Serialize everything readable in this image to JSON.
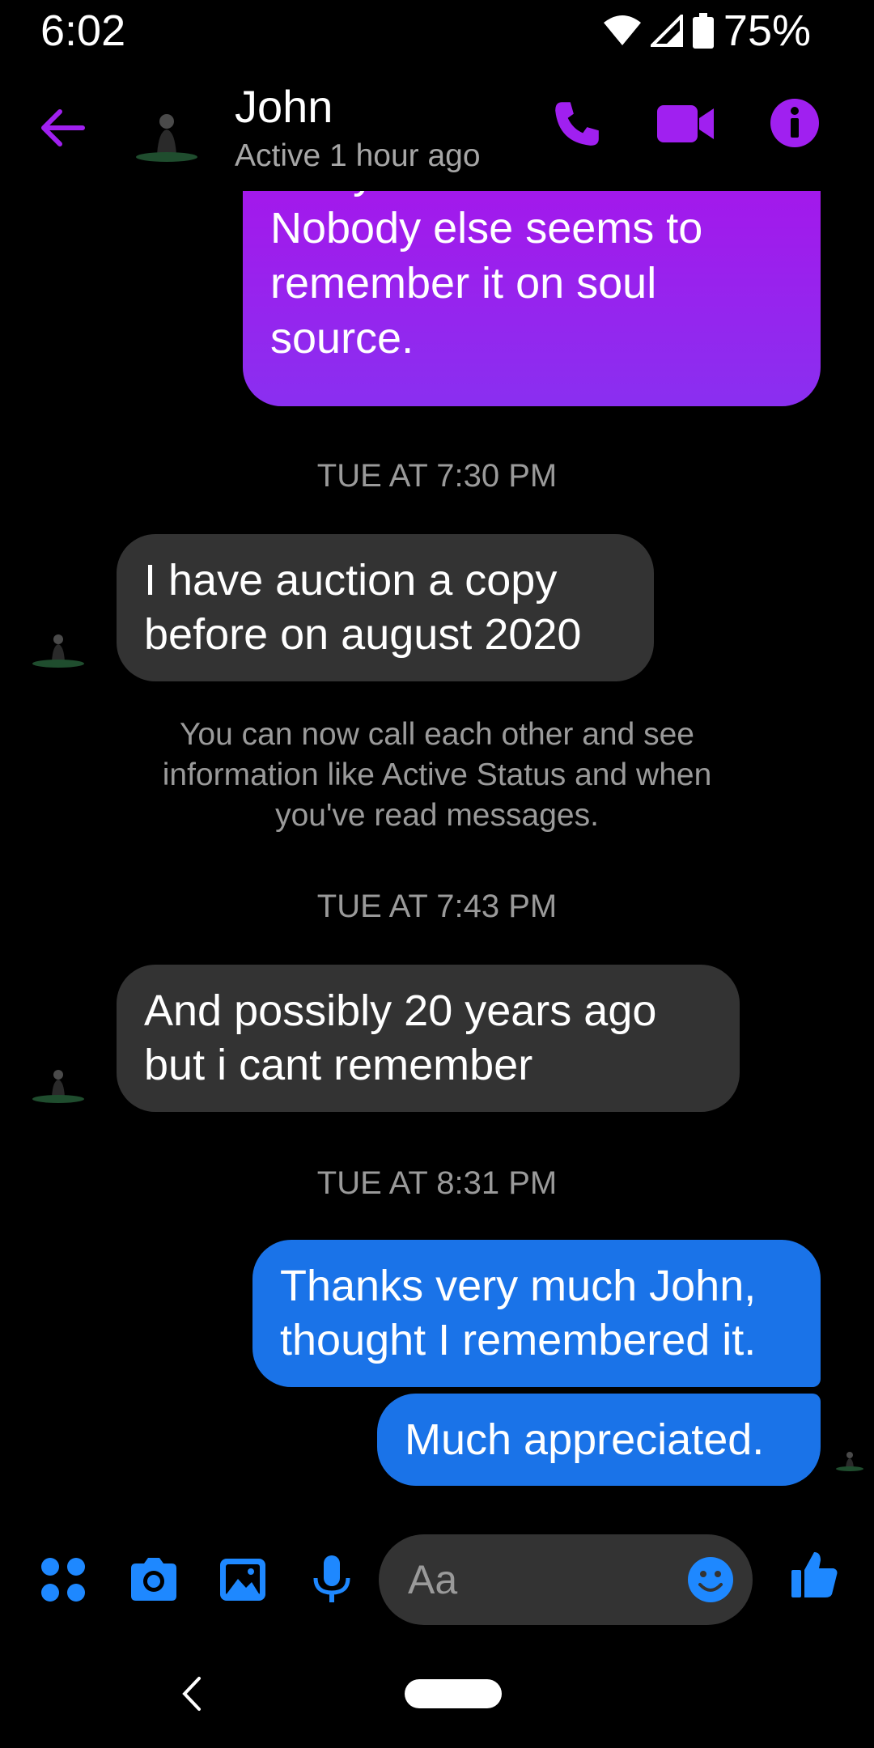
{
  "status_bar": {
    "time": "6:02",
    "battery": "75%"
  },
  "header": {
    "name": "John",
    "status": "Active 1 hour ago",
    "icons": [
      "back-arrow-icon",
      "phone-icon",
      "video-camera-icon",
      "info-icon"
    ]
  },
  "colors": {
    "accent": "#a020f0",
    "sent_purple_top": "#a814ea",
    "sent_purple_bottom": "#8a2ff0",
    "sent_blue": "#1a73e8",
    "received_bg": "#333333",
    "icon_blue": "#1e88ff"
  },
  "messages": [
    {
      "side": "sent",
      "text": "can you confirm?\nNobody else seems to\nremember it on soul\nsource."
    },
    {
      "timestamp": "TUE AT 7:30 PM"
    },
    {
      "side": "received",
      "text": "I have auction a copy\nbefore  on august 2020"
    },
    {
      "notice": "You can now call each other and see information like Active Status and when you've read messages."
    },
    {
      "timestamp": "TUE AT 7:43 PM"
    },
    {
      "side": "received",
      "text": "And possibly 20 years ago\nbut i cant remember"
    },
    {
      "timestamp": "TUE AT 8:31 PM"
    },
    {
      "side": "sent",
      "text": "Thanks very much John,\nthought I remembered it."
    },
    {
      "side": "sent",
      "text": "Much appreciated."
    }
  ],
  "composer": {
    "placeholder": "Aa",
    "icons": [
      "apps-icon",
      "camera-icon",
      "gallery-icon",
      "microphone-icon",
      "emoji-icon",
      "thumbs-up-icon"
    ]
  }
}
